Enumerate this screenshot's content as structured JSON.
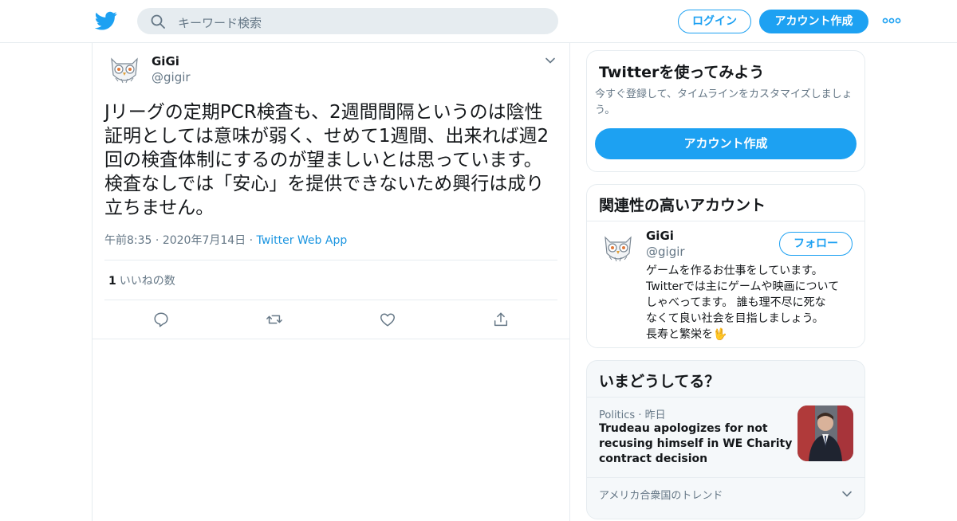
{
  "header": {
    "search_placeholder": "キーワード検索",
    "login_label": "ログイン",
    "signup_label": "アカウント作成"
  },
  "tweet": {
    "display_name": "GiGi",
    "handle": "@gigir",
    "text_lines": [
      "Jリーグの定期PCR検査も、2週間間隔というのは陰性",
      "証明としては意味が弱く、せめて1週間、出来れば週2",
      "回の検査体制にするのが望ましいとは思っています。",
      "検査なしでは「安心」を提供できないため興行は成り",
      "立ちません。"
    ],
    "time": "午前8:35",
    "date": "2020年7月14日",
    "source": "Twitter Web App",
    "like_count": "1",
    "like_label": "いいねの数"
  },
  "sidebar": {
    "signup_card": {
      "title": "Twitterを使ってみよう",
      "description": "今すぐ登録して、タイムラインをカスタマイズしましょう。",
      "button_label": "アカウント作成"
    },
    "related_card": {
      "title": "関連性の高いアカウント",
      "display_name": "GiGi",
      "handle": "@gigir",
      "follow_label": "フォロー",
      "bio_lines": [
        "ゲームを作るお仕事をしています。",
        "Twitterでは主にゲームや映画について",
        "しゃべってます。 誰も理不尽に死な",
        "なくて良い社会を目指しましょう。",
        "長寿と繁栄を🖖"
      ]
    },
    "trends_card": {
      "title": "いまどうしてる？",
      "category": "Politics",
      "time": "昨日",
      "headline": "Trudeau apologizes for not recusing himself in WE Charity contract decision",
      "trend_label": "アメリカ合衆国のトレンド"
    }
  },
  "colors": {
    "accent": "#1da1f2",
    "link": "#1b95e0",
    "muted": "#657786",
    "border": "#e6ecf0"
  },
  "icons": [
    "twitter-bird-icon",
    "search-icon",
    "more-icon",
    "chevron-down-icon",
    "reply-icon",
    "retweet-icon",
    "like-icon",
    "share-icon"
  ]
}
